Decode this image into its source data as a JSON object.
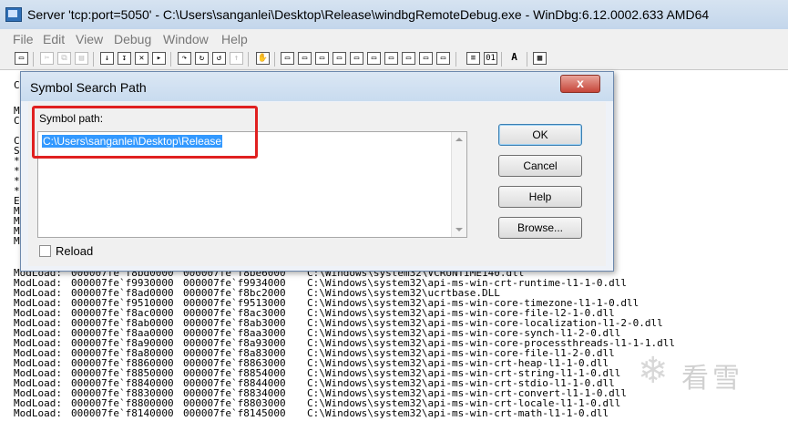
{
  "window": {
    "title": "Server 'tcp:port=5050' - C:\\Users\\sanganlei\\Desktop\\Release\\windbgRemoteDebug.exe - WinDbg:6.12.0002.633 AMD64"
  },
  "menu": [
    "File",
    "Edit",
    "View",
    "Debug",
    "Window",
    "Help"
  ],
  "toolbar": {
    "buttons": [
      "open-icon",
      "cut-icon",
      "copy-icon",
      "paste-icon",
      "step-into-icon",
      "step-over-icon",
      "break-icon",
      "go-icon",
      "step-out-icon",
      "run-to-cursor-icon",
      "breakpoint-icon",
      "hand-icon",
      "command-icon",
      "watch-icon",
      "locals-icon",
      "registers-icon",
      "memory-icon",
      "call-stack-icon",
      "disassembly-icon",
      "scratch-pad-icon",
      "source-mode-icon",
      "hex-icon",
      "font-icon",
      "options-icon"
    ]
  },
  "left_column_chars": [
    "C",
    "",
    "M",
    "C",
    "",
    "C",
    "S",
    "*",
    "*",
    "*",
    "*",
    "E",
    "M",
    "M",
    "M",
    "M"
  ],
  "module_loads": [
    {
      "label": "ModLoad:",
      "start": "000007fe`f8bd0000",
      "end": "000007fe`f8be6000",
      "path": "C:\\Windows\\system32\\VCRUNTIME140.dll"
    },
    {
      "label": "ModLoad:",
      "start": "000007fe`f9930000",
      "end": "000007fe`f9934000",
      "path": "C:\\Windows\\system32\\api-ms-win-crt-runtime-l1-1-0.dll"
    },
    {
      "label": "ModLoad:",
      "start": "000007fe`f8ad0000",
      "end": "000007fe`f8bc2000",
      "path": "C:\\Windows\\system32\\ucrtbase.DLL"
    },
    {
      "label": "ModLoad:",
      "start": "000007fe`f9510000",
      "end": "000007fe`f9513000",
      "path": "C:\\Windows\\system32\\api-ms-win-core-timezone-l1-1-0.dll"
    },
    {
      "label": "ModLoad:",
      "start": "000007fe`f8ac0000",
      "end": "000007fe`f8ac3000",
      "path": "C:\\Windows\\system32\\api-ms-win-core-file-l2-1-0.dll"
    },
    {
      "label": "ModLoad:",
      "start": "000007fe`f8ab0000",
      "end": "000007fe`f8ab3000",
      "path": "C:\\Windows\\system32\\api-ms-win-core-localization-l1-2-0.dll"
    },
    {
      "label": "ModLoad:",
      "start": "000007fe`f8aa0000",
      "end": "000007fe`f8aa3000",
      "path": "C:\\Windows\\system32\\api-ms-win-core-synch-l1-2-0.dll"
    },
    {
      "label": "ModLoad:",
      "start": "000007fe`f8a90000",
      "end": "000007fe`f8a93000",
      "path": "C:\\Windows\\system32\\api-ms-win-core-processthreads-l1-1-1.dll"
    },
    {
      "label": "ModLoad:",
      "start": "000007fe`f8a80000",
      "end": "000007fe`f8a83000",
      "path": "C:\\Windows\\system32\\api-ms-win-core-file-l1-2-0.dll"
    },
    {
      "label": "ModLoad:",
      "start": "000007fe`f8860000",
      "end": "000007fe`f8863000",
      "path": "C:\\Windows\\system32\\api-ms-win-crt-heap-l1-1-0.dll"
    },
    {
      "label": "ModLoad:",
      "start": "000007fe`f8850000",
      "end": "000007fe`f8854000",
      "path": "C:\\Windows\\system32\\api-ms-win-crt-string-l1-1-0.dll"
    },
    {
      "label": "ModLoad:",
      "start": "000007fe`f8840000",
      "end": "000007fe`f8844000",
      "path": "C:\\Windows\\system32\\api-ms-win-crt-stdio-l1-1-0.dll"
    },
    {
      "label": "ModLoad:",
      "start": "000007fe`f8830000",
      "end": "000007fe`f8834000",
      "path": "C:\\Windows\\system32\\api-ms-win-crt-convert-l1-1-0.dll"
    },
    {
      "label": "ModLoad:",
      "start": "000007fe`f8800000",
      "end": "000007fe`f8803000",
      "path": "C:\\Windows\\system32\\api-ms-win-crt-locale-l1-1-0.dll"
    },
    {
      "label": "ModLoad:",
      "start": "000007fe`f8140000",
      "end": "000007fe`f8145000",
      "path": "C:\\Windows\\system32\\api-ms-win-crt-math-l1-1-0.dll"
    }
  ],
  "dialog": {
    "title": "Symbol Search Path",
    "close_label": "x",
    "symbol_label": "Symbol path:",
    "symbol_value": "C:\\Users\\sanganlei\\Desktop\\Release",
    "reload_label": "Reload",
    "reload_checked": false,
    "buttons": {
      "ok": "OK",
      "cancel": "Cancel",
      "help": "Help",
      "browse": "Browse..."
    }
  },
  "watermark": {
    "text": "看雪",
    "icon": "snowflake-icon"
  },
  "colors": {
    "highlight_box": "#e02020",
    "selection": "#3399ff"
  }
}
